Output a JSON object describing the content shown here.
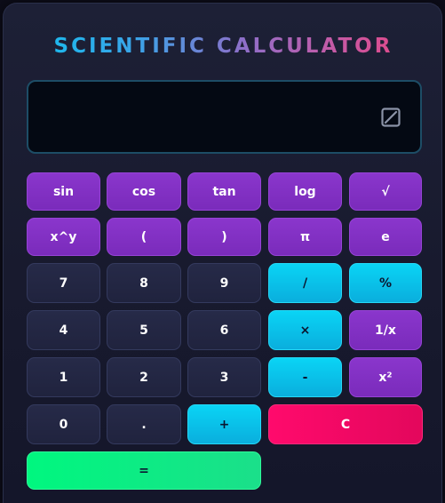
{
  "app": {
    "title": "SCIENTIFIC CALCULATOR"
  },
  "display": {
    "value": "",
    "clear_icon": "square-slash-icon"
  },
  "colors": {
    "function_key": "#7e2fc1",
    "number_key": "#232643",
    "operator_key": "#0bc4ed",
    "clear_key": "#f5086a",
    "equals_key": "#08ef84",
    "title_gradient_start": "#0ec2ee",
    "title_gradient_end": "#f0407a"
  },
  "keys": {
    "sin": "sin",
    "cos": "cos",
    "tan": "tan",
    "log": "log",
    "sqrt": "√",
    "power": "x^y",
    "open_paren": "(",
    "close_paren": ")",
    "pi": "π",
    "e": "e",
    "seven": "7",
    "eight": "8",
    "nine": "9",
    "divide": "/",
    "percent": "%",
    "four": "4",
    "five": "5",
    "six": "6",
    "multiply": "×",
    "reciprocal": "1/x",
    "one": "1",
    "two": "2",
    "three": "3",
    "subtract": "-",
    "square": "x²",
    "zero": "0",
    "decimal": ".",
    "add": "+",
    "clear": "C",
    "equals": "="
  }
}
